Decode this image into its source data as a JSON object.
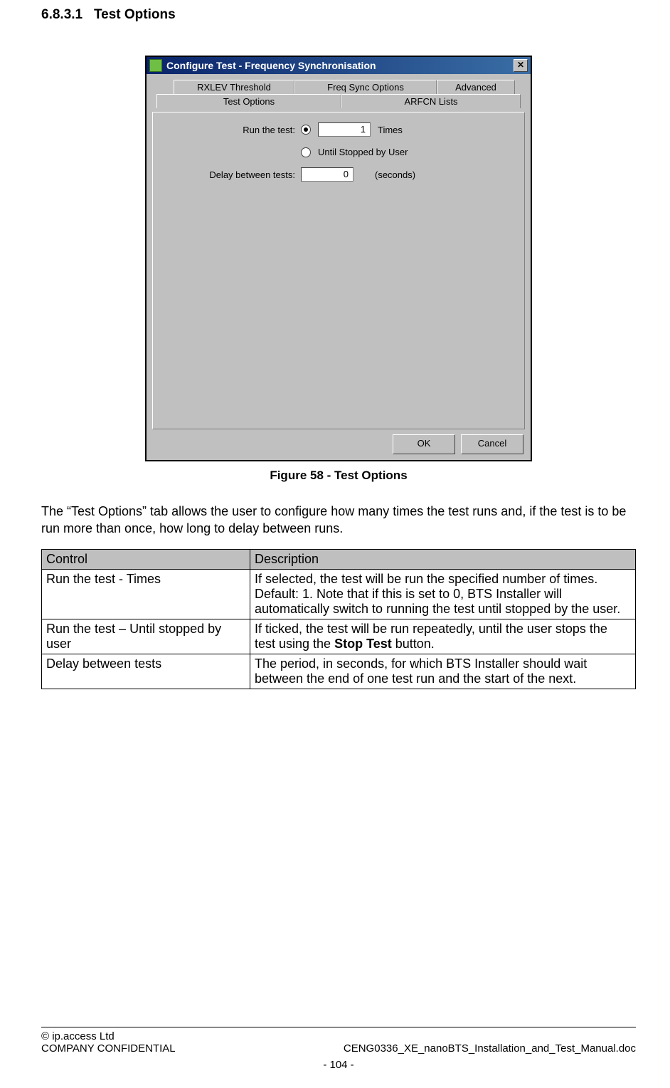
{
  "section": {
    "number": "6.8.3.1",
    "title": "Test Options"
  },
  "dialog": {
    "window_title": "Configure Test - Frequency Synchronisation",
    "tabs": {
      "rxlev": "RXLEV Threshold",
      "freq_sync": "Freq Sync Options",
      "advanced": "Advanced",
      "test_options": "Test Options",
      "arfcn_lists": "ARFCN Lists"
    },
    "fields": {
      "run_label": "Run the test:",
      "run_times_value": "1",
      "run_times_suffix": "Times",
      "until_stopped": "Until Stopped by User",
      "delay_label": "Delay between tests:",
      "delay_value": "0",
      "delay_suffix": "(seconds)"
    },
    "buttons": {
      "ok": "OK",
      "cancel": "Cancel"
    }
  },
  "figure_caption": "Figure 58 - Test Options",
  "intro_para": "The “Test Options” tab allows the user to configure how many times the test runs and, if the test is to be run more than once, how long to delay between runs.",
  "table": {
    "headers": {
      "control": "Control",
      "description": "Description"
    },
    "rows": [
      {
        "control": "Run the test - Times",
        "desc": "If selected, the test will be run the specified number of times. Default: 1. Note that if this is set to 0, BTS Installer will automatically switch to running the test until stopped by the user."
      },
      {
        "control": "Run the test – Until stopped by user",
        "desc_prefix": "If ticked, the test will be run repeatedly, until the user stops the test using the ",
        "desc_bold": "Stop Test",
        "desc_suffix": " button."
      },
      {
        "control": "Delay between tests",
        "desc": "The period, in seconds, for which BTS Installer should wait between the end of one test run and the start of the next."
      }
    ]
  },
  "footer": {
    "copyright": "© ip.access Ltd",
    "confidential": "COMPANY CONFIDENTIAL",
    "docname": "CENG0336_XE_nanoBTS_Installation_and_Test_Manual.doc",
    "page_number": "- 104 -"
  }
}
